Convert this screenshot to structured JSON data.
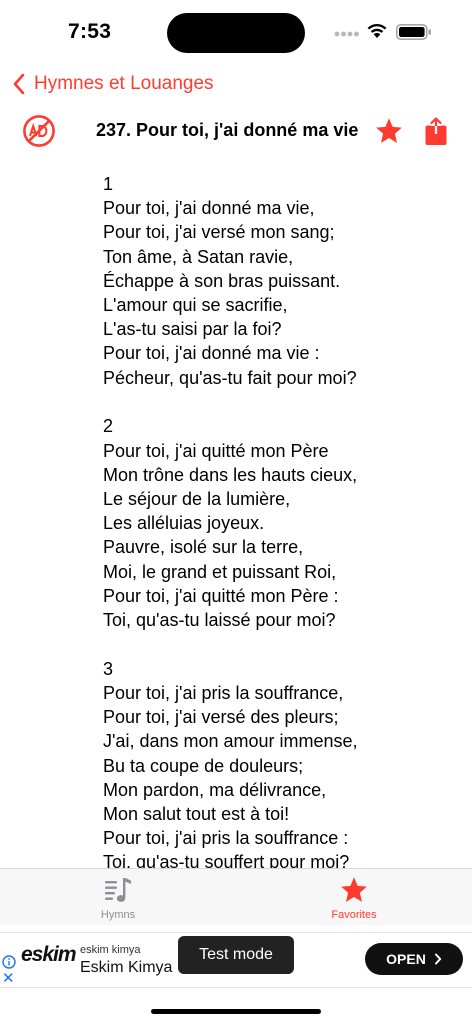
{
  "status": {
    "time": "7:53"
  },
  "nav": {
    "back_label": "Hymnes et Louanges"
  },
  "hymn": {
    "title": "237. Pour toi, j'ai donné ma vie",
    "verses": [
      {
        "number": "1",
        "lines": [
          "Pour toi, j'ai donné ma vie,",
          "Pour toi, j'ai versé mon sang;",
          "Ton âme, à Satan ravie,",
          "Échappe à son bras puissant.",
          "L'amour qui se sacrifie,",
          "L'as-tu saisi par la foi?",
          "Pour toi, j'ai donné ma vie :",
          "Pécheur, qu'as-tu fait pour moi?"
        ]
      },
      {
        "number": "2",
        "lines": [
          "Pour toi, j'ai quitté mon Père",
          "Mon trône dans les hauts cieux,",
          "Le séjour de la lumière,",
          "Les alléluias joyeux.",
          "Pauvre, isolé sur la terre,",
          "Moi, le grand et puissant Roi,",
          "Pour toi, j'ai quitté mon Père :",
          "Toi, qu'as-tu laissé pour moi?"
        ]
      },
      {
        "number": "3",
        "lines": [
          "Pour toi, j'ai pris la souffrance,",
          "Pour toi, j'ai versé des pleurs;",
          "J'ai, dans mon amour immense,",
          "Bu ta coupe de douleurs;",
          "Mon pardon, ma délivrance,",
          "Mon salut tout est à toi!",
          "Pour toi, j'ai pris la souffrance :",
          "Toi, qu'as-tu souffert pour moi?"
        ]
      }
    ]
  },
  "tabs": [
    {
      "label": "Hymns",
      "icon": "music-note-list-icon",
      "active": false
    },
    {
      "label": "Favorites",
      "icon": "star-icon",
      "active": true
    }
  ],
  "ad": {
    "logo": "eskim",
    "advertiser_sub": "eskim kimya",
    "advertiser_name": "Eskim Kimya",
    "test_mode": "Test mode",
    "cta": "OPEN",
    "close": "✕"
  },
  "colors": {
    "accent": "#ff3b30",
    "tab_inactive": "#8e8e93"
  }
}
